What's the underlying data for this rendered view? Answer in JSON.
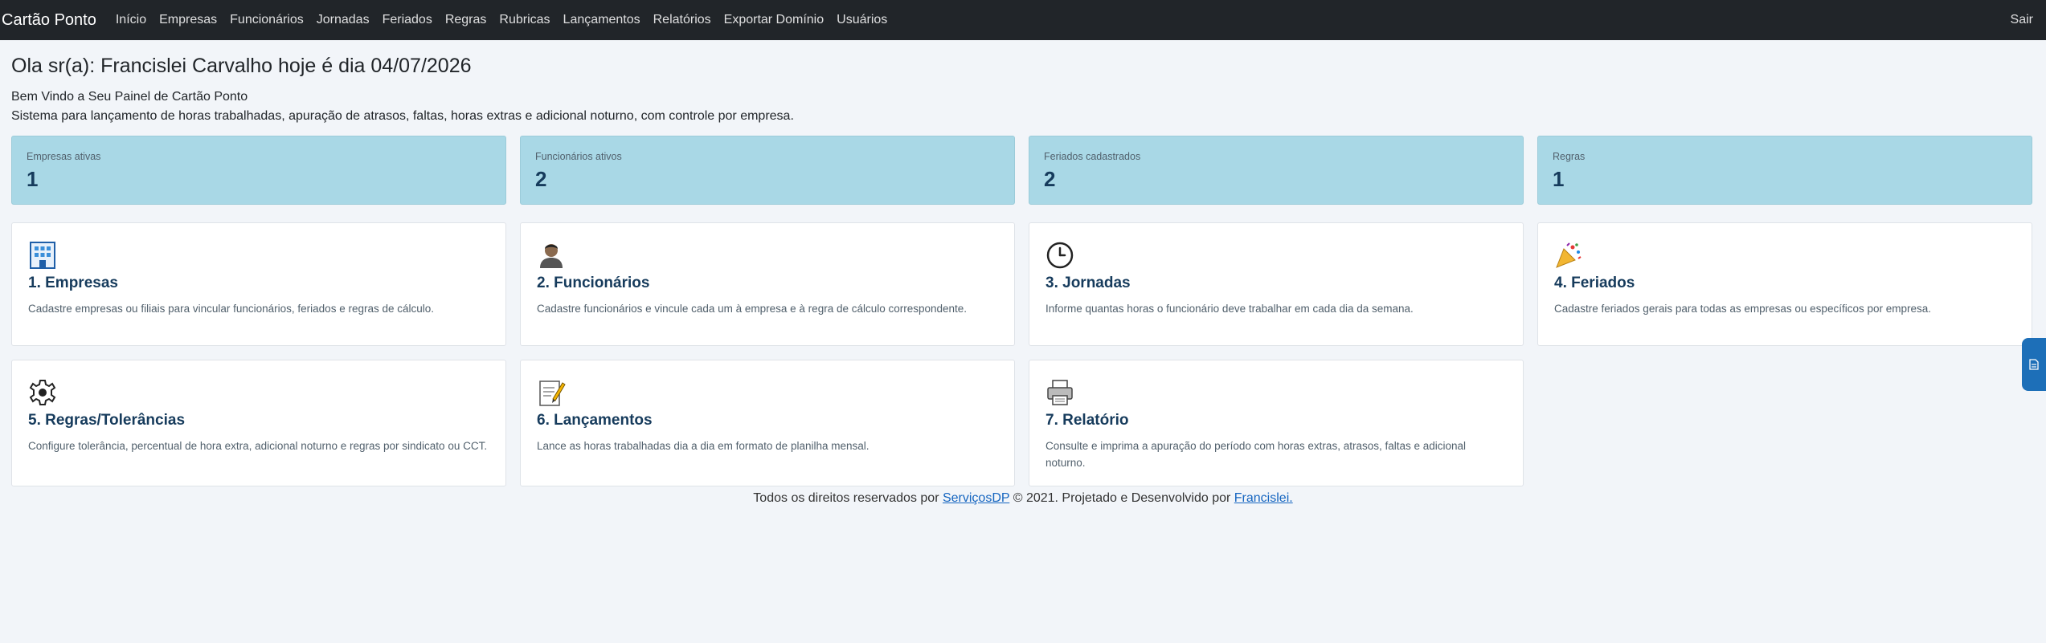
{
  "nav": {
    "brand": "Cartão Ponto",
    "links": [
      "Início",
      "Empresas",
      "Funcionários",
      "Jornadas",
      "Feriados",
      "Regras",
      "Rubricas",
      "Lançamentos",
      "Relatórios",
      "Exportar Domínio",
      "Usuários"
    ],
    "logout": "Sair"
  },
  "header": {
    "greeting": "Ola sr(a): Francislei Carvalho hoje é dia 04/07/2026",
    "welcome": "Bem Vindo a Seu Painel de Cartão Ponto",
    "description": "Sistema para lançamento de horas trabalhadas, apuração de atrasos, faltas, horas extras e adicional noturno, com controle por empresa."
  },
  "stats": [
    {
      "label": "Empresas ativas",
      "value": "1"
    },
    {
      "label": "Funcionários ativos",
      "value": "2"
    },
    {
      "label": "Feriados cadastrados",
      "value": "2"
    },
    {
      "label": "Regras",
      "value": "1"
    }
  ],
  "cards": [
    {
      "icon": "building-icon",
      "title": "1. Empresas",
      "text": "Cadastre empresas ou filiais para vincular funcionários, feriados e regras de cálculo."
    },
    {
      "icon": "person-icon",
      "title": "2. Funcionários",
      "text": "Cadastre funcionários e vincule cada um à empresa e à regra de cálculo correspondente."
    },
    {
      "icon": "clock-icon",
      "title": "3. Jornadas",
      "text": "Informe quantas horas o funcionário deve trabalhar em cada dia da semana."
    },
    {
      "icon": "party-popper-icon",
      "title": "4. Feriados",
      "text": "Cadastre feriados gerais para todas as empresas ou específicos por empresa."
    },
    {
      "icon": "gear-icon",
      "title": "5. Regras/Tolerâncias",
      "text": "Configure tolerância, percentual de hora extra, adicional noturno e regras por sindicato ou CCT."
    },
    {
      "icon": "memo-icon",
      "title": "6. Lançamentos",
      "text": "Lance as horas trabalhadas dia a dia em formato de planilha mensal."
    },
    {
      "icon": "printer-icon",
      "title": "7. Relatório",
      "text": "Consulte e imprima a apuração do período com horas extras, atrasos, faltas e adicional noturno."
    }
  ],
  "footer": {
    "prefix": "Todos os direitos reservados por ",
    "link1": "ServiçosDP",
    "middle": " © 2021. Projetado e Desenvolvido por ",
    "link2": "Francislei."
  },
  "side_tab_icon": "document-icon"
}
